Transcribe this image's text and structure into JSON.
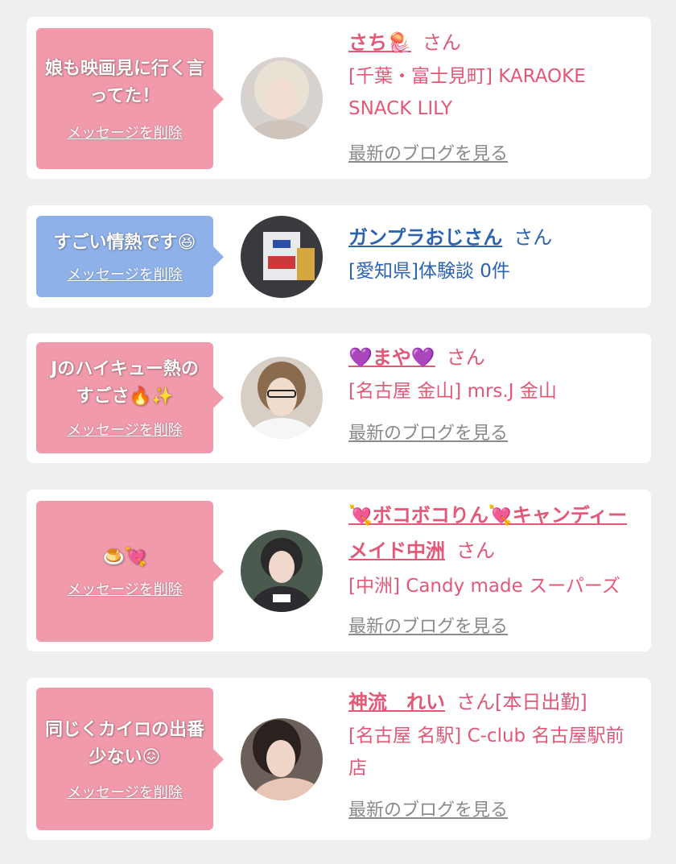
{
  "delete_label": "メッセージを削除",
  "blog_label": "最新のブログを見る",
  "honorific": "さん",
  "colors": {
    "pink_bubble": "#f09aab",
    "blue_bubble": "#8fb1ea",
    "pink_text": "#e25877",
    "blue_text": "#2c63b1",
    "background": "#efeff0"
  },
  "messages": [
    {
      "bubble_text": "娘も映画見に行く言ってた！",
      "name": "さち🪼",
      "suffix": "",
      "store": "[千葉・富士見町] KARAOKE SNACK LILY",
      "has_blog": true
    },
    {
      "bubble_text": "すごい情熱です😆",
      "name": "ガンプラおじさん",
      "suffix": "",
      "store": "[愛知県]体験談 0件",
      "has_blog": false
    },
    {
      "bubble_text": "Jのハイキュー熱のすごさ🔥✨",
      "name": "💜まや💜",
      "suffix": "",
      "store": "[名古屋 金山] mrs.J 金山",
      "has_blog": true
    },
    {
      "bubble_text": "🍮💘",
      "name": "💘ボコボコりん💘キャンディーメイド中洲",
      "suffix": "",
      "store": "[中洲] Candy made スーパーズ",
      "has_blog": true
    },
    {
      "bubble_text": "同じくカイロの出番少ない😖",
      "name": "神流　れい",
      "suffix": "[本日出勤]",
      "store": "[名古屋 名駅] C-club 名古屋駅前店",
      "has_blog": true
    }
  ]
}
